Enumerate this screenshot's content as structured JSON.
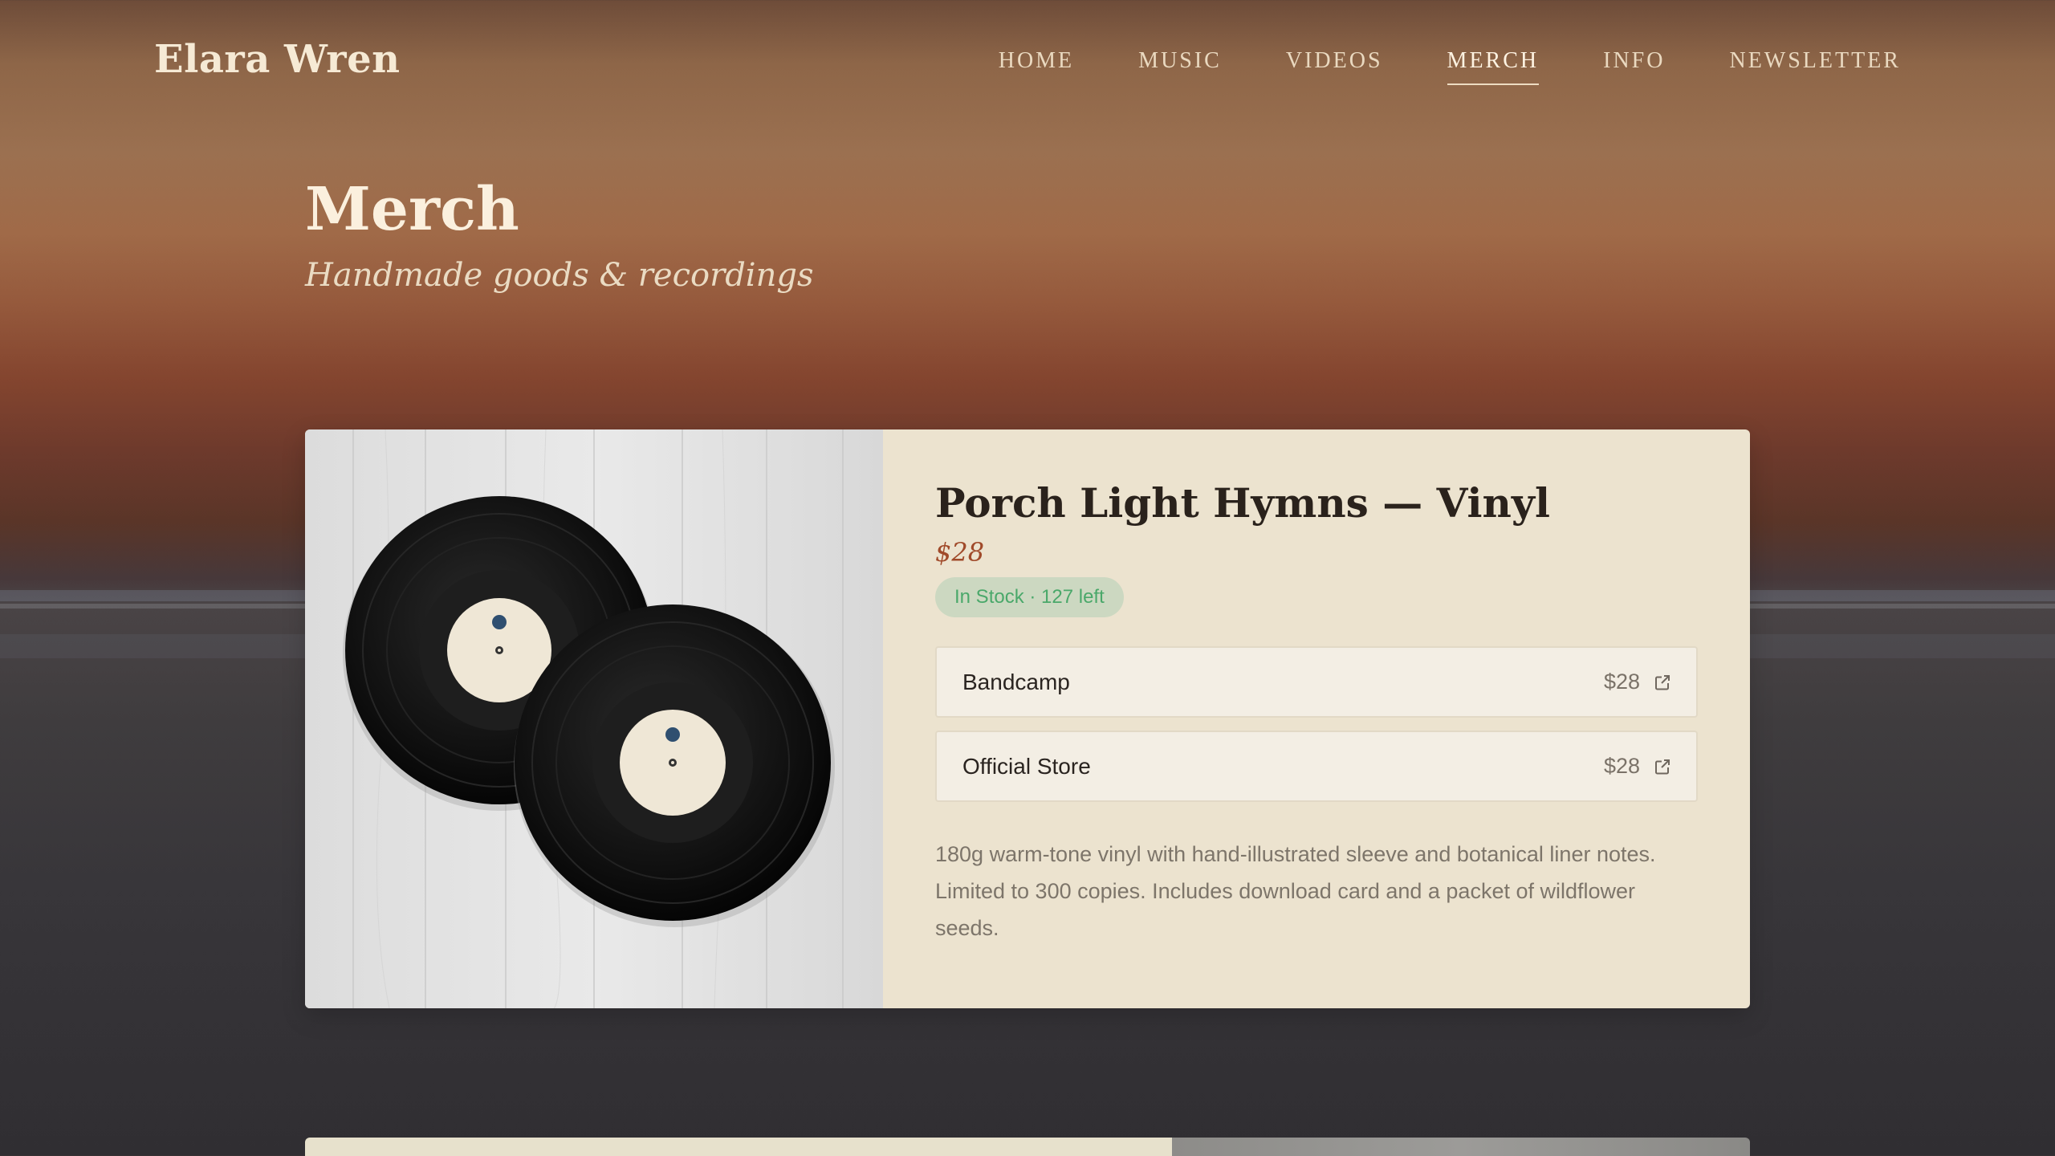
{
  "header": {
    "brand": "Elara Wren",
    "nav": [
      {
        "label": "HOME",
        "active": false
      },
      {
        "label": "MUSIC",
        "active": false
      },
      {
        "label": "VIDEOS",
        "active": false
      },
      {
        "label": "MERCH",
        "active": true
      },
      {
        "label": "INFO",
        "active": false
      },
      {
        "label": "NEWSLETTER",
        "active": false
      }
    ]
  },
  "page": {
    "title": "Merch",
    "subtitle": "Handmade goods & recordings"
  },
  "product": {
    "title": "Porch Light Hymns — Vinyl",
    "price": "$28",
    "stock": "In Stock · 127 left",
    "stores": [
      {
        "name": "Bandcamp",
        "price": "$28",
        "icon": "external-link-icon"
      },
      {
        "name": "Official Store",
        "price": "$28",
        "icon": "external-link-icon"
      }
    ],
    "description": "180g warm-tone vinyl with hand-illustrated sleeve and botanical liner notes. Limited to 300 copies. Includes download card and a packet of wildflower seeds.",
    "image": "vinyl-records-photo"
  },
  "colors": {
    "accent_price": "#a04a2a",
    "stock_green": "#4aa86a",
    "card_bg": "#ece3cf"
  }
}
